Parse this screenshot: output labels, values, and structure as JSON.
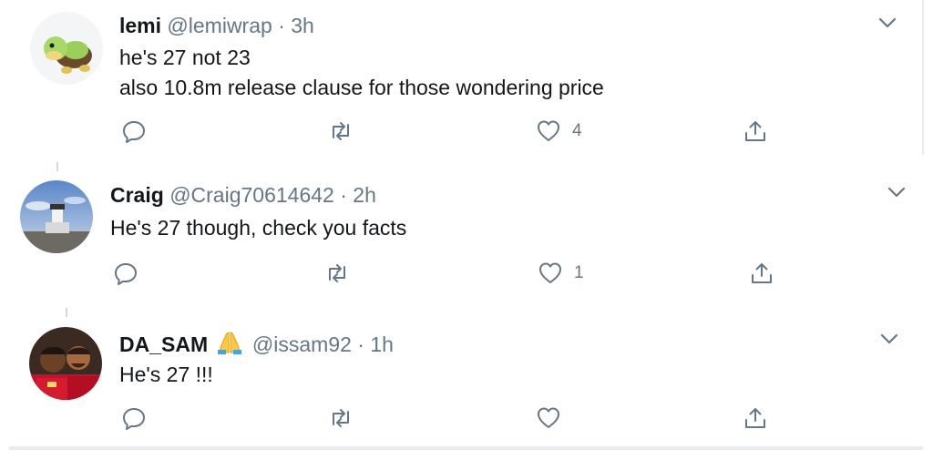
{
  "tweets": [
    {
      "name": "lemi",
      "handle": "@lemiwrap",
      "separator": "·",
      "time": "3h",
      "lines": [
        "he's 27 not 23",
        "also 10.8m release clause for those wondering price"
      ],
      "like_count": "4",
      "avatar_icon": "turtle-avatar"
    },
    {
      "name": "Craig",
      "handle": "@Craig70614642",
      "separator": "·",
      "time": "2h",
      "lines": [
        "He's 27 though, check you facts"
      ],
      "like_count": "1",
      "avatar_icon": "lighthouse-avatar"
    },
    {
      "name": "DA_SAM",
      "handle": "@issam92",
      "separator": "·",
      "time": "1h",
      "lines": [
        "He's 27 !!!"
      ],
      "like_count": "",
      "avatar_icon": "players-avatar",
      "name_emoji": "folded-hands-icon"
    }
  ],
  "colors": {
    "text": "#14171a",
    "secondary": "#657786",
    "border": "#e6ecf0"
  }
}
